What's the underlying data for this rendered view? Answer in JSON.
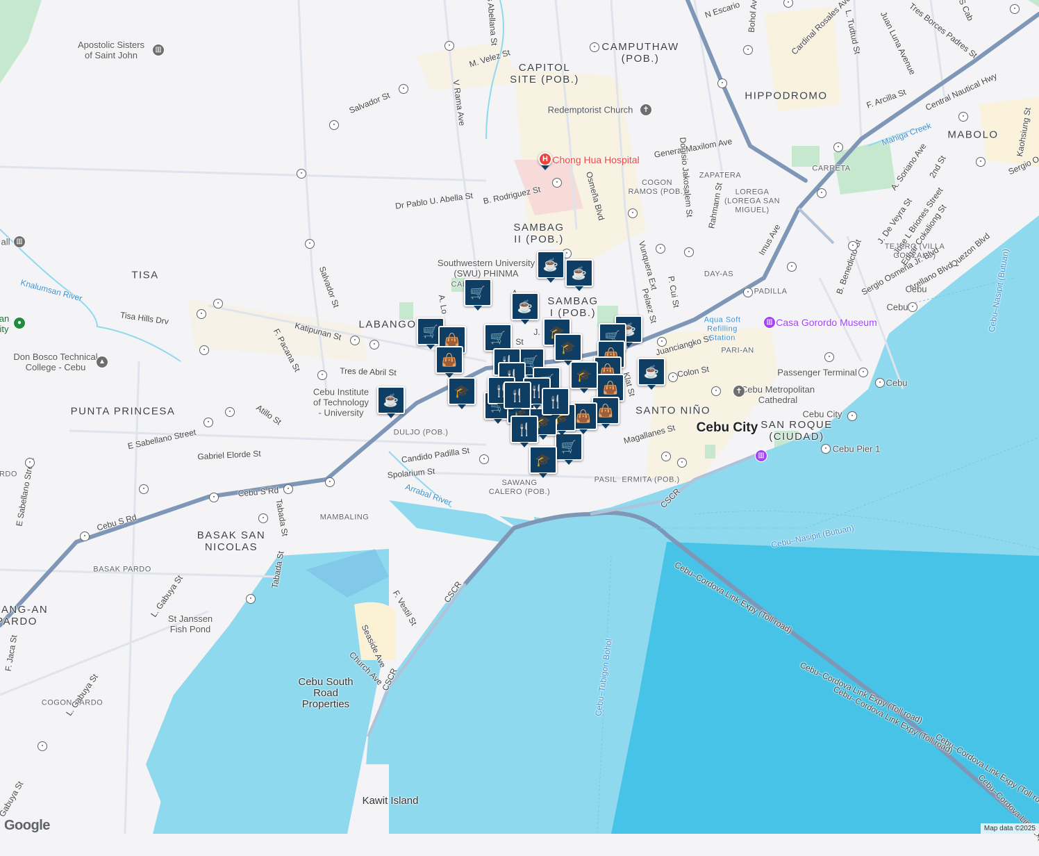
{
  "map": {
    "area_labels": [
      {
        "id": "camputhaw",
        "text": "CAMPUTHAW\n(POB.)"
      },
      {
        "id": "capitol",
        "text": "CAPITOL\nSITE (POB.)"
      },
      {
        "id": "hippodromo",
        "text": "HIPPODROMO"
      },
      {
        "id": "mabolo",
        "text": "MABOLO"
      },
      {
        "id": "sambag2",
        "text": "SAMBAG\nII (POB.)"
      },
      {
        "id": "sambag1",
        "text": "SAMBAG\nI (POB.)"
      },
      {
        "id": "tisa",
        "text": "TISA"
      },
      {
        "id": "labangon",
        "text": "LABANGO"
      },
      {
        "id": "punta",
        "text": "PUNTA PRINCESA"
      },
      {
        "id": "santonino",
        "text": "SANTO NIÑO"
      },
      {
        "id": "sanroque",
        "text": "SAN ROQUE\n(CIUDAD)"
      },
      {
        "id": "basak",
        "text": "BASAK SAN\nNICOLAS"
      },
      {
        "id": "pasil",
        "text": "PASIL"
      },
      {
        "id": "inayawan",
        "text": "ASANG-AN\nPARDO"
      }
    ],
    "small_labels": [
      {
        "id": "carreta",
        "text": "CARRETA"
      },
      {
        "id": "zapatera",
        "text": "ZAPATERA"
      },
      {
        "id": "cogon",
        "text": "COGON\nRAMOS (POB.)"
      },
      {
        "id": "lorega",
        "text": "LOREGA\n(LOREGA SAN\nMIGUEL)"
      },
      {
        "id": "tejero",
        "text": "TEJERO (VILLA\nGONZALO)"
      },
      {
        "id": "dayas",
        "text": "DAY-AS"
      },
      {
        "id": "tpadilla",
        "text": "T. PADILLA"
      },
      {
        "id": "parian",
        "text": "PARI-AN"
      },
      {
        "id": "duljo",
        "text": "DULJO (POB.)"
      },
      {
        "id": "sawang",
        "text": "SAWANG\nCALERO (POB.)"
      },
      {
        "id": "ermita",
        "text": "ERMITA (POB.)"
      },
      {
        "id": "mambaling",
        "text": "MAMBALING"
      },
      {
        "id": "basakpardo",
        "text": "BASAK PARDO"
      },
      {
        "id": "cogonpardo",
        "text": "COGON PARDO"
      },
      {
        "id": "ardo",
        "text": "ARDO"
      },
      {
        "id": "cal",
        "text": "CAL"
      }
    ],
    "road_labels": [
      {
        "id": "mvelez",
        "text": "M. Velez St"
      },
      {
        "id": "salvador1",
        "text": "Salvador St"
      },
      {
        "id": "salvador2",
        "text": "Salvador St"
      },
      {
        "id": "vrama",
        "text": "V Rama Ave"
      },
      {
        "id": "abellana",
        "text": "dres Abellana St"
      },
      {
        "id": "nescario",
        "text": "N Escario"
      },
      {
        "id": "bohol",
        "text": "Bohol Ave"
      },
      {
        "id": "cardinal",
        "text": "Cardinal Rosales Ave"
      },
      {
        "id": "tudtud",
        "text": "L. Tudtud St"
      },
      {
        "id": "juanluna",
        "text": "Juan Luna Avenue"
      },
      {
        "id": "tresborces",
        "text": "Tres Borces Padres St"
      },
      {
        "id": "farcilla",
        "text": "F. Arcilla St"
      },
      {
        "id": "centralnautical",
        "text": "Central Nautical Hwy"
      },
      {
        "id": "maxilom",
        "text": "General Maxilom Ave"
      },
      {
        "id": "jakosalem",
        "text": "Donisio Jakosalem St"
      },
      {
        "id": "brodriguez",
        "text": "B. Rodriguez St"
      },
      {
        "id": "drpablo",
        "text": "Dr Pablo U. Abella St"
      },
      {
        "id": "osmena",
        "text": "Osmeña Blvd"
      },
      {
        "id": "rahmann",
        "text": "Rahmann St"
      },
      {
        "id": "kaohsiung",
        "text": "Kaohsiung St"
      },
      {
        "id": "sergio1",
        "text": "Sergio Osmeña Jr. Blvd"
      },
      {
        "id": "sergio2",
        "text": "Sergio O"
      },
      {
        "id": "asoriano",
        "text": "A. Soriano Ave"
      },
      {
        "id": "2nd",
        "text": "2nd St"
      },
      {
        "id": "devera",
        "text": "J. De Veyra St"
      },
      {
        "id": "briones",
        "text": "Jose L Briones Street"
      },
      {
        "id": "cokaliong",
        "text": "Edgar Cokaliong St"
      },
      {
        "id": "benedicto",
        "text": "B. Benedicto St"
      },
      {
        "id": "quezon",
        "text": "Quezon Blvd"
      },
      {
        "id": "arellano",
        "text": "Arellano Blvd"
      },
      {
        "id": "imus",
        "text": "Imus Ave"
      },
      {
        "id": "vunquera",
        "text": "Vunquera Ext"
      },
      {
        "id": "pelaez",
        "text": "Pelaez St"
      },
      {
        "id": "pcui",
        "text": "P. Cui St"
      },
      {
        "id": "katipunan",
        "text": "Katipunan St"
      },
      {
        "id": "tisahills",
        "text": "Tisa Hills Drv"
      },
      {
        "id": "tresdeabril",
        "text": "Tres de Abril St"
      },
      {
        "id": "fpacana",
        "text": "F. Pacana St"
      },
      {
        "id": "atillo",
        "text": "Atillo St"
      },
      {
        "id": "esabellano1",
        "text": "E Sabellano Street"
      },
      {
        "id": "esabellano2",
        "text": "E Sabellano Street"
      },
      {
        "id": "gelorde",
        "text": "Gabriel Elorde St"
      },
      {
        "id": "cebusrd1",
        "text": "Cebu S Rd"
      },
      {
        "id": "cebusrd2",
        "text": "Cebu S Rd"
      },
      {
        "id": "candido",
        "text": "Candido Padilla St"
      },
      {
        "id": "spolarium",
        "text": "Spolarium St"
      },
      {
        "id": "tabada1",
        "text": "Tabada St"
      },
      {
        "id": "tabada2",
        "text": "Tabada St"
      },
      {
        "id": "lgabuya1",
        "text": "L. Gabuya St"
      },
      {
        "id": "lgabuya2",
        "text": "L. Gabuya St"
      },
      {
        "id": "fjaca",
        "text": "F. Jaca St"
      },
      {
        "id": "gabuya3",
        "text": "Gabuya St"
      },
      {
        "id": "fvestil",
        "text": "F. Vestil St"
      },
      {
        "id": "seaside",
        "text": "Seaside Ave"
      },
      {
        "id": "church",
        "text": "Church Ave"
      },
      {
        "id": "cscr1",
        "text": "CSCR"
      },
      {
        "id": "cscr2",
        "text": "CSCR"
      },
      {
        "id": "cscr3",
        "text": "CSCR"
      },
      {
        "id": "magallanes",
        "text": "Magallanes St"
      },
      {
        "id": "colon",
        "text": "Colon St"
      },
      {
        "id": "juanciangko",
        "text": "Juanciangko St"
      },
      {
        "id": "klat",
        "text": "Klat St"
      },
      {
        "id": "alo",
        "text": "A. Lo"
      },
      {
        "id": "ccla1",
        "text": "Cebu–Cordova Link Expy (Toll road)"
      },
      {
        "id": "ccla2",
        "text": "Cebu–Cordova Link Expy (Toll road)"
      },
      {
        "id": "ccla3",
        "text": "Cebu–Cordova Link Expy (Toll road)"
      },
      {
        "id": "ccla4",
        "text": "Cebu–Cordova Link Expy (To"
      },
      {
        "id": "ccla5",
        "text": "Cebu–Cordova Link Expy (Toll road)"
      },
      {
        "id": "jst",
        "text": "J."
      },
      {
        "id": "st",
        "text": "St"
      },
      {
        "id": "ast",
        "text": "A"
      },
      {
        "id": "sst",
        "text": "S Cab"
      },
      {
        "id": "cbrs",
        "text": "Cebu–Nasipit (Butuan)"
      },
      {
        "id": "cbrs2",
        "text": "Cebu–Nasipit (Butuan)"
      },
      {
        "id": "ctb",
        "text": "Cebu–Tubigon Bohol"
      },
      {
        "id": "rosales",
        "text": "Sergio Osmeña Jr. Blvd"
      }
    ],
    "poi_labels": [
      {
        "id": "apostolic",
        "text": "Apostolic Sisters\nof Saint John"
      },
      {
        "id": "redemptorist",
        "text": "Redemptorist Church"
      },
      {
        "id": "chonghua",
        "text": "Chong Hua Hospital"
      },
      {
        "id": "swu",
        "text": "Southwestern University\n(SWU) PHINMA"
      },
      {
        "id": "donbosco",
        "text": "Don Bosco Technical\nCollege - Cebu"
      },
      {
        "id": "citu",
        "text": "Cebu Institute\nof Technology\n- University"
      },
      {
        "id": "gorordo",
        "text": "Casa Gorordo Museum"
      },
      {
        "id": "aquasoft",
        "text": "Aqua Soft\nRefilling\nStation"
      },
      {
        "id": "metropolitan",
        "text": "Cebu Metropolitan\nCathedral"
      },
      {
        "id": "cebucity",
        "text": "Cebu City"
      },
      {
        "id": "passenger",
        "text": "Passenger Terminal 2"
      },
      {
        "id": "pier1",
        "text": "Cebu Pier 1"
      },
      {
        "id": "cebuport",
        "text": "Cebu City"
      },
      {
        "id": "cebu1",
        "text": "Cebu"
      },
      {
        "id": "cebu2",
        "text": "Cebu"
      },
      {
        "id": "cebu3",
        "text": "Cebu"
      },
      {
        "id": "srp",
        "text": "Cebu South\nRoad\nProperties"
      },
      {
        "id": "kawit",
        "text": "Kawit Island"
      },
      {
        "id": "janssen",
        "text": "St Janssen\nFish Pond"
      },
      {
        "id": "all",
        "text": "all"
      },
      {
        "id": "an",
        "text": "an\nity"
      },
      {
        "id": "knalumsan",
        "text": "Knalumsan River"
      },
      {
        "id": "arrabal",
        "text": "Arrabal River"
      },
      {
        "id": "mahiga",
        "text": "Mahiga Creek"
      }
    ],
    "markers": [
      {
        "type": "cafe",
        "icon": "cafe-icon"
      },
      {
        "type": "cafe",
        "icon": "cafe-icon"
      },
      {
        "type": "cafe",
        "icon": "cafe-icon"
      },
      {
        "type": "cafe",
        "icon": "cafe-icon"
      },
      {
        "type": "cafe",
        "icon": "cafe-icon"
      },
      {
        "type": "cafe",
        "icon": "cafe-icon"
      },
      {
        "type": "grocery",
        "icon": "shopping-cart-icon"
      },
      {
        "type": "grocery",
        "icon": "shopping-cart-icon"
      },
      {
        "type": "grocery",
        "icon": "shopping-cart-icon"
      },
      {
        "type": "grocery",
        "icon": "shopping-cart-icon"
      },
      {
        "type": "grocery",
        "icon": "shopping-cart-icon"
      },
      {
        "type": "grocery",
        "icon": "shopping-cart-icon"
      },
      {
        "type": "grocery",
        "icon": "shopping-cart-icon"
      },
      {
        "type": "grocery",
        "icon": "shopping-cart-icon"
      },
      {
        "type": "shopping",
        "icon": "shopping-bag-icon"
      },
      {
        "type": "shopping",
        "icon": "shopping-bag-icon"
      },
      {
        "type": "shopping",
        "icon": "shopping-bag-icon"
      },
      {
        "type": "shopping",
        "icon": "shopping-bag-icon"
      },
      {
        "type": "shopping",
        "icon": "shopping-bag-icon"
      },
      {
        "type": "shopping",
        "icon": "shopping-bag-icon"
      },
      {
        "type": "shopping",
        "icon": "shopping-bag-icon"
      },
      {
        "type": "school",
        "icon": "graduation-cap-icon"
      },
      {
        "type": "school",
        "icon": "graduation-cap-icon"
      },
      {
        "type": "school",
        "icon": "graduation-cap-icon"
      },
      {
        "type": "school",
        "icon": "graduation-cap-icon"
      },
      {
        "type": "school",
        "icon": "graduation-cap-icon"
      },
      {
        "type": "school",
        "icon": "graduation-cap-icon"
      },
      {
        "type": "school",
        "icon": "graduation-cap-icon"
      },
      {
        "type": "school",
        "icon": "graduation-cap-icon"
      },
      {
        "type": "restaurant",
        "icon": "fork-knife-icon"
      },
      {
        "type": "restaurant",
        "icon": "fork-knife-icon"
      },
      {
        "type": "restaurant",
        "icon": "fork-knife-icon"
      },
      {
        "type": "restaurant",
        "icon": "fork-knife-icon"
      },
      {
        "type": "restaurant",
        "icon": "fork-knife-icon"
      },
      {
        "type": "restaurant",
        "icon": "fork-knife-icon"
      },
      {
        "type": "restaurant",
        "icon": "fork-knife-icon"
      }
    ],
    "colors": {
      "water": "#8fd9ef",
      "deep_water": "#46c3e6",
      "land": "#f4f3f6",
      "highway": "#7f97b6",
      "road": "#dfe4ec",
      "park": "#c6e8cf",
      "commercial": "#fbf1d4",
      "marker": "#0f3e64",
      "hospital": "#f6d4d4"
    }
  },
  "attribution": {
    "logo": "Google",
    "map_data": "Map data ©2025"
  }
}
